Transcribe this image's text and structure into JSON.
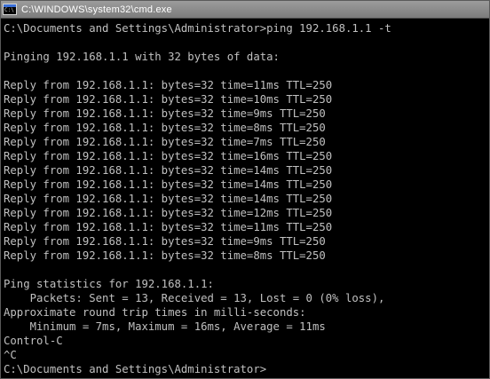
{
  "window": {
    "title": "C:\\WINDOWS\\system32\\cmd.exe",
    "icon": "cmd-icon"
  },
  "console": {
    "lines": [
      "C:\\Documents and Settings\\Administrator>ping 192.168.1.1 -t",
      "",
      "Pinging 192.168.1.1 with 32 bytes of data:",
      "",
      "Reply from 192.168.1.1: bytes=32 time=11ms TTL=250",
      "Reply from 192.168.1.1: bytes=32 time=10ms TTL=250",
      "Reply from 192.168.1.1: bytes=32 time=9ms TTL=250",
      "Reply from 192.168.1.1: bytes=32 time=8ms TTL=250",
      "Reply from 192.168.1.1: bytes=32 time=7ms TTL=250",
      "Reply from 192.168.1.1: bytes=32 time=16ms TTL=250",
      "Reply from 192.168.1.1: bytes=32 time=14ms TTL=250",
      "Reply from 192.168.1.1: bytes=32 time=14ms TTL=250",
      "Reply from 192.168.1.1: bytes=32 time=14ms TTL=250",
      "Reply from 192.168.1.1: bytes=32 time=12ms TTL=250",
      "Reply from 192.168.1.1: bytes=32 time=11ms TTL=250",
      "Reply from 192.168.1.1: bytes=32 time=9ms TTL=250",
      "Reply from 192.168.1.1: bytes=32 time=8ms TTL=250",
      "",
      "Ping statistics for 192.168.1.1:",
      "    Packets: Sent = 13, Received = 13, Lost = 0 (0% loss),",
      "Approximate round trip times in milli-seconds:",
      "    Minimum = 7ms, Maximum = 16ms, Average = 11ms",
      "Control-C",
      "^C",
      "C:\\Documents and Settings\\Administrator>"
    ]
  },
  "colors": {
    "background": "#000000",
    "text": "#c0c0c0",
    "titlebar": "#8a8a8a"
  }
}
